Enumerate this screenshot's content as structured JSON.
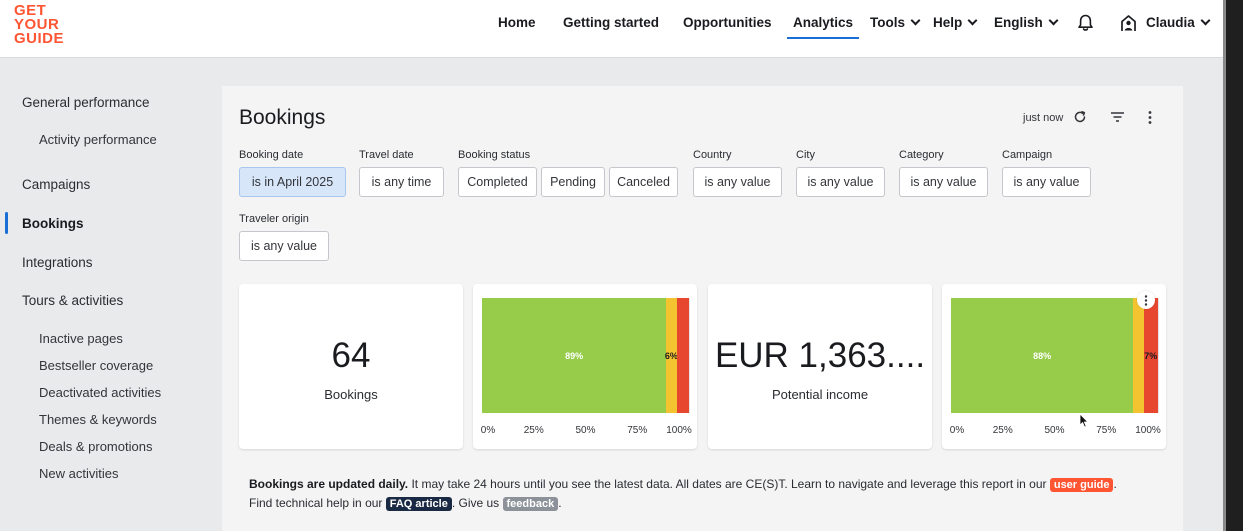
{
  "brand": {
    "line1": "GET",
    "line2": "YOUR",
    "line3": "GUIDE",
    "color": "#ff5533"
  },
  "nav": {
    "home": "Home",
    "getting_started": "Getting started",
    "opportunities": "Opportunities",
    "analytics": "Analytics",
    "tools": "Tools",
    "help": "Help",
    "language": "English",
    "user": "Claudia",
    "accent": "#1a6fd6"
  },
  "sidebar": {
    "general_performance": "General performance",
    "activity_performance": "Activity performance",
    "campaigns": "Campaigns",
    "bookings": "Bookings",
    "integrations": "Integrations",
    "tours_activities": "Tours & activities",
    "inactive_pages": "Inactive pages",
    "bestseller_coverage": "Bestseller coverage",
    "deactivated_activities": "Deactivated activities",
    "themes_keywords": "Themes & keywords",
    "deals_promotions": "Deals & promotions",
    "new_activities": "New activities"
  },
  "report": {
    "title": "Bookings",
    "updated": "just now",
    "icons": [
      "refresh-icon",
      "filter-icon",
      "more-vert-icon"
    ]
  },
  "filters": {
    "booking_date": {
      "label": "Booking date",
      "value": "is in April 2025"
    },
    "travel_date": {
      "label": "Travel date",
      "value": "is any time"
    },
    "booking_status": {
      "label": "Booking status",
      "options": [
        "Completed",
        "Pending",
        "Canceled"
      ]
    },
    "country": {
      "label": "Country",
      "value": "is any value"
    },
    "city": {
      "label": "City",
      "value": "is any value"
    },
    "category": {
      "label": "Category",
      "value": "is any value"
    },
    "campaign": {
      "label": "Campaign",
      "value": "is any value"
    },
    "traveler_origin": {
      "label": "Traveler origin",
      "value": "is any value"
    }
  },
  "kpis": {
    "bookings": {
      "value": "64",
      "label": "Bookings"
    },
    "income": {
      "value": "EUR 1,363....",
      "label": "Potential income"
    }
  },
  "chart_data": [
    {
      "type": "bar",
      "orientation": "horizontal-stacked",
      "categories": [
        ""
      ],
      "series": [
        {
          "values": [
            89
          ],
          "color": "#96cc4a",
          "label": "89%"
        },
        {
          "values": [
            5
          ],
          "color": "#f4c430",
          "label": "6%"
        },
        {
          "values": [
            6
          ],
          "color": "#e8472f",
          "label": ""
        }
      ],
      "xticks": [
        "0%",
        "25%",
        "50%",
        "75%",
        "100%"
      ],
      "xlim": [
        0,
        100
      ],
      "grid": true
    },
    {
      "type": "bar",
      "orientation": "horizontal-stacked",
      "categories": [
        ""
      ],
      "series": [
        {
          "values": [
            88
          ],
          "color": "#96cc4a",
          "label": "88%"
        },
        {
          "values": [
            5
          ],
          "color": "#f4c430",
          "label": ""
        },
        {
          "values": [
            7
          ],
          "color": "#e8472f",
          "label": "7%"
        }
      ],
      "xticks": [
        "0%",
        "25%",
        "50%",
        "75%",
        "100%"
      ],
      "xlim": [
        0,
        100
      ],
      "grid": true
    }
  ],
  "note": {
    "bold": "Bookings are updated daily.",
    "text1": " It may take 24 hours until you see the latest data. All dates are CE(S)T. Learn to navigate and leverage this report in our ",
    "guide": "user guide",
    "text2": ". Find technical help in our ",
    "faq": "FAQ article",
    "text3": ". Give us ",
    "feedback": "feedback",
    "text4": "."
  }
}
